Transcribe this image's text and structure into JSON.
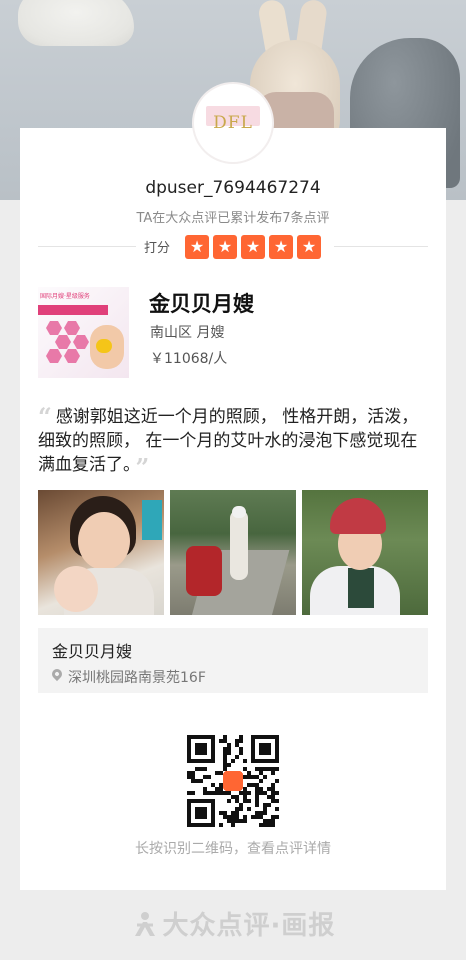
{
  "profile": {
    "username": "dpuser_7694467274",
    "summary": "TA在大众点评已累计发布7条点评",
    "rating_label": "打分",
    "stars": 5,
    "star_color": "#ff6633"
  },
  "logo": {
    "text": "DFL"
  },
  "shop": {
    "name": "金贝贝月嫂",
    "meta": "南山区 月嫂",
    "price": "￥11068/人",
    "thumb_text": "国际月嫂·星级服务"
  },
  "review": {
    "text": "感谢郭姐这近一个月的照顾， 性格开朗，活泼，细致的照顾， 在一个月的艾叶水的浸泡下感觉现在满血复活了。"
  },
  "photos": [
    "mother-with-baby",
    "woman-with-motorcycle",
    "woman-with-helmet"
  ],
  "location": {
    "name": "金贝贝月嫂",
    "address": "深圳桃园路南景苑16F"
  },
  "qr": {
    "hint": "长按识别二维码，查看点评详情"
  },
  "footer": {
    "brand": "大众点评·画报"
  }
}
